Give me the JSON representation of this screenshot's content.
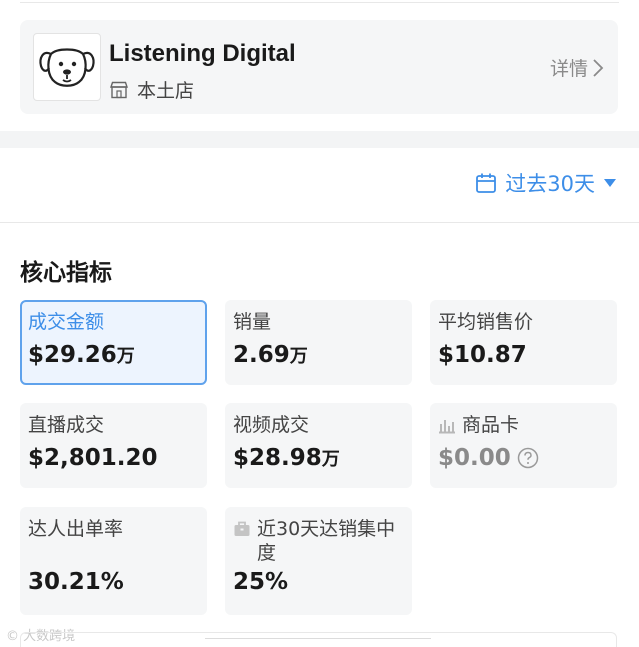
{
  "shop": {
    "name": "Listening Digital",
    "type_label": "本土店",
    "detail_label": "详情"
  },
  "date_filter": {
    "label": "过去30天"
  },
  "core_metrics": {
    "title": "核心指标",
    "items": [
      {
        "label": "成交金额",
        "value": "$29.26",
        "unit": "万"
      },
      {
        "label": "销量",
        "value": "2.69",
        "unit": "万"
      },
      {
        "label": "平均销售价",
        "value": "$10.87",
        "unit": ""
      },
      {
        "label": "直播成交",
        "value": "$2,801.20",
        "unit": ""
      },
      {
        "label": "视频成交",
        "value": "$28.98",
        "unit": "万"
      },
      {
        "label": "商品卡",
        "value": "$0.00",
        "unit": ""
      },
      {
        "label": "达人出单率",
        "value": "30.21%",
        "unit": ""
      },
      {
        "label": "近30天达销集中度",
        "value": "25%",
        "unit": ""
      }
    ]
  },
  "watermark": "© 大数跨境",
  "colors": {
    "accent": "#3d8ee8",
    "active_border": "#5fa2ec",
    "card_bg": "#f5f6f7"
  }
}
